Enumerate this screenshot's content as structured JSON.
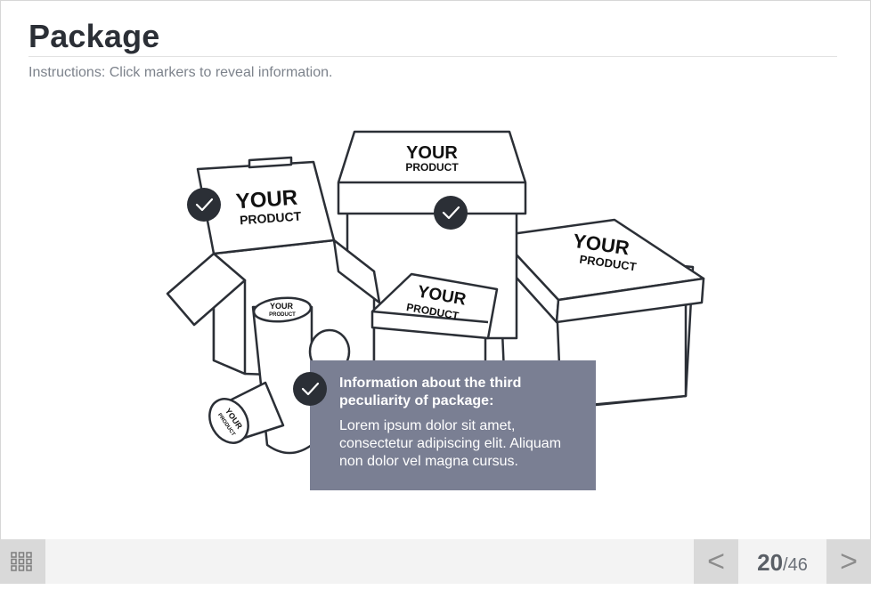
{
  "page": {
    "title": "Package",
    "instructions": "Instructions: Click markers to reveal information."
  },
  "illustration": {
    "label_your": "YOUR",
    "label_product": "PRODUCT"
  },
  "popup": {
    "title": "Information about the third peculiarity of package:",
    "body": "Lorem ipsum dolor sit amet, consectetur adipiscing elit. Aliquam non dolor vel magna cursus."
  },
  "navigation": {
    "prev_label": "<",
    "next_label": ">",
    "current_slide": "20",
    "total_slides": "/46"
  },
  "colors": {
    "marker": "#2b2f36",
    "popup_bg": "#7a7f93",
    "bar_bg": "#f3f3f3",
    "button_bg": "#d9d9d9"
  },
  "icons": {
    "marker": "checkmark-icon",
    "menu": "grid-icon"
  }
}
